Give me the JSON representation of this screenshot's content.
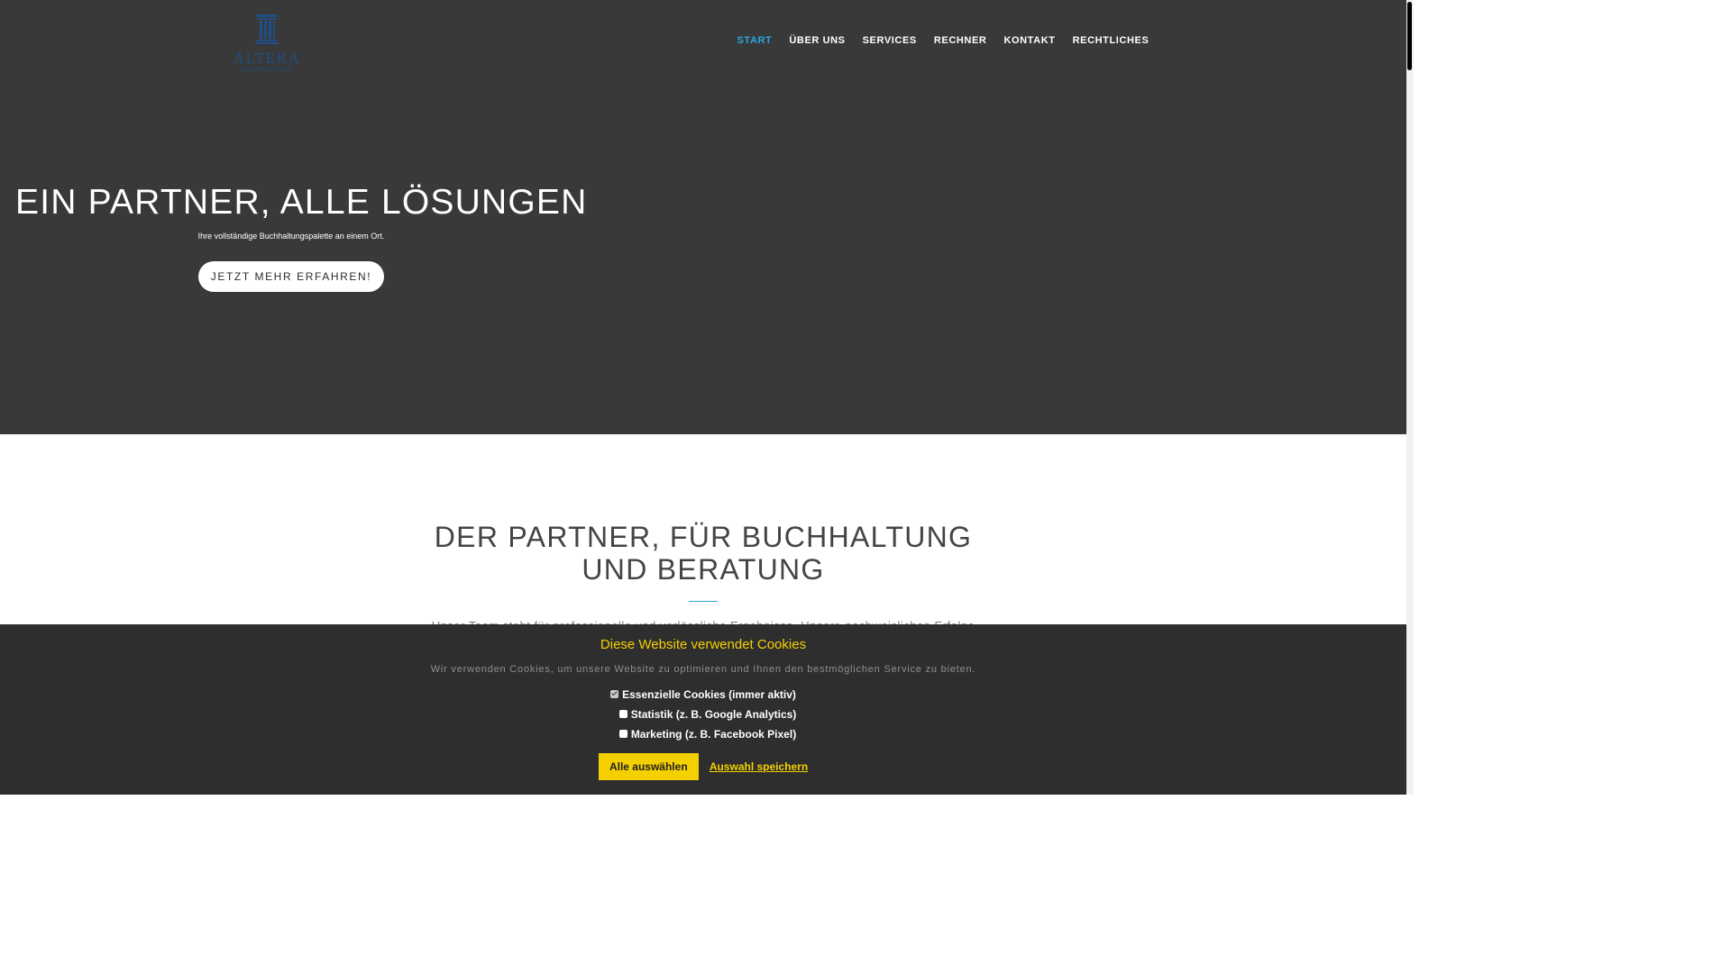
{
  "colors": {
    "hero_background": "#393939",
    "nav_active": "#2aa8e0",
    "accent_yellow": "#f5d000",
    "cookie_background": "#2e2e2e"
  },
  "logo": {
    "icon": "column-pillar-icon",
    "name": "ALTERA",
    "tagline": "BUCHHALTUNG"
  },
  "nav": {
    "items": [
      {
        "label": "START",
        "active": true
      },
      {
        "label": "ÜBER UNS",
        "active": false
      },
      {
        "label": "SERVICES",
        "active": false
      },
      {
        "label": "RECHNER",
        "active": false
      },
      {
        "label": "KONTAKT",
        "active": false
      },
      {
        "label": "RECHTLICHES",
        "active": false
      }
    ]
  },
  "hero": {
    "title": "EIN PARTNER, ALLE LÖSUNGEN",
    "subtitle": "Ihre vollständige Buchhaltungspalette an einem Ort.",
    "cta_label": "JETZT MEHR ERFAHREN!"
  },
  "section": {
    "title_line1": "DER PARTNER, FÜR BUCHHALTUNG",
    "title_line2": "UND BERATUNG",
    "text": "Unser Team steht für professionelle und verlässliche Ergebnisse. Unsere nachweislichen Erfolge"
  },
  "cookie": {
    "title": "Diese Website verwendet Cookies",
    "text": "Wir verwenden Cookies, um unsere Website zu optimieren und Ihnen den bestmöglichen Service zu bieten.",
    "options": [
      {
        "label": "Essenzielle Cookies (immer aktiv)",
        "checked": true
      },
      {
        "label": "Statistik (z. B. Google Analytics)",
        "checked": false
      },
      {
        "label": "Marketing (z. B. Facebook Pixel)",
        "checked": false
      }
    ],
    "accept_label": "Alle auswählen",
    "save_label": "Auswahl speichern"
  }
}
